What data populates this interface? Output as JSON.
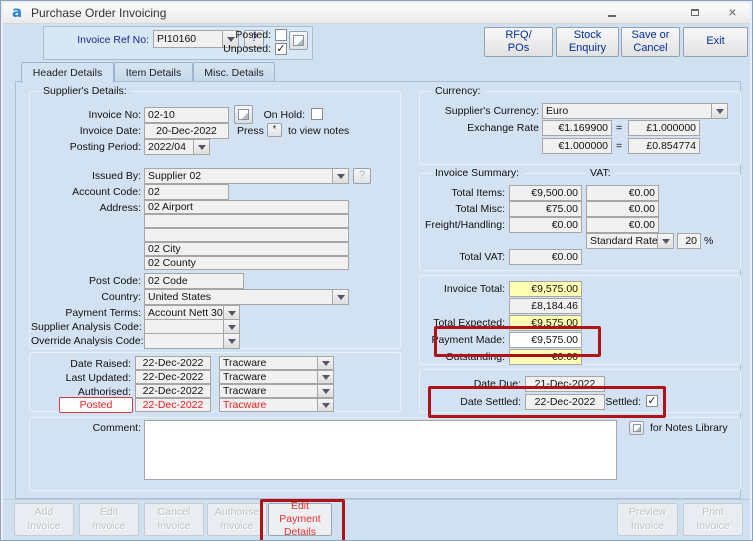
{
  "window": {
    "title": "Purchase Order Invoicing",
    "logo_letter": "a"
  },
  "header": {
    "invoice_ref": {
      "label": "Invoice Ref No:",
      "value": "PI10160"
    },
    "help_button": "?",
    "posted": {
      "label": "Posted:",
      "checked": false
    },
    "unposted": {
      "label": "Unposted:",
      "checked": true
    },
    "actions": {
      "rfq_pos": [
        "RFQ/",
        "POs"
      ],
      "stock_enquiry": [
        "Stock",
        "Enquiry"
      ],
      "save_or_cancel": [
        "Save or",
        "Cancel"
      ],
      "exit": "Exit"
    }
  },
  "tabs": [
    {
      "label": "Header Details"
    },
    {
      "label": "Item Details"
    },
    {
      "label": "Misc. Details"
    }
  ],
  "supplier_details": {
    "legend": "Supplier's Details:",
    "invoice_no": {
      "label": "Invoice No:",
      "value": "02-10"
    },
    "on_hold": {
      "label": "On Hold:",
      "checked": false
    },
    "invoice_date": {
      "label": "Invoice Date:",
      "value": "20-Dec-2022"
    },
    "notes_hint": {
      "prefix": "Press",
      "key": "*",
      "suffix": "to view notes"
    },
    "posting_period": {
      "label": "Posting Period:",
      "value": "2022/04"
    },
    "issued_by": {
      "label": "Issued By:",
      "value": "Supplier 02",
      "help": "?"
    },
    "account_code": {
      "label": "Account Code:",
      "value": "02"
    },
    "address": {
      "label": "Address:",
      "lines": [
        "02 Airport",
        "",
        "",
        "02 City",
        "02 County"
      ]
    },
    "post_code": {
      "label": "Post Code:",
      "value": "02 Code"
    },
    "country": {
      "label": "Country:",
      "value": "United States"
    },
    "payment_terms": {
      "label": "Payment Terms:",
      "value": "Account Nett 30"
    },
    "supplier_analysis_code": {
      "label": "Supplier Analysis Code:",
      "value": ""
    },
    "override_analysis_code": {
      "label": "Override Analysis Code:",
      "value": ""
    }
  },
  "audit": {
    "rows": [
      {
        "label": "Date Raised:",
        "date": "22-Dec-2022",
        "user": "Tracware"
      },
      {
        "label": "Last Updated:",
        "date": "22-Dec-2022",
        "user": "Tracware"
      },
      {
        "label": "Authorised:",
        "date": "22-Dec-2022",
        "user": "Tracware"
      },
      {
        "label": "Posted",
        "date": "22-Dec-2022",
        "user": "Tracware"
      }
    ]
  },
  "currency": {
    "legend": "Currency:",
    "suppliers_currency": {
      "label": "Supplier's Currency:",
      "value": "Euro"
    },
    "exchange_rate_label": "Exchange Rate",
    "rates": [
      {
        "from": "€1.169900",
        "equals": "=",
        "to": "£1.000000"
      },
      {
        "from": "€1.000000",
        "equals": "=",
        "to": "£0.854774"
      }
    ]
  },
  "invoice_summary": {
    "legend": "Invoice Summary:",
    "vat_heading": "VAT:",
    "total_items": {
      "label": "Total Items:",
      "value": "€9,500.00",
      "vat": "€0.00"
    },
    "total_misc": {
      "label": "Total Misc:",
      "value": "€75.00",
      "vat": "€0.00"
    },
    "freight_handling": {
      "label": "Freight/Handling:",
      "value": "€0.00",
      "vat": "€0.00"
    },
    "vat_rate": {
      "name": "Standard Rate",
      "percent": "20",
      "percent_sign": "%"
    },
    "total_vat": {
      "label": "Total VAT:",
      "value": "€0.00"
    }
  },
  "totals": {
    "invoice_total": {
      "label": "Invoice Total:",
      "value": "€9,575.00"
    },
    "invoice_total_base": "£8,184.46",
    "total_expected": {
      "label": "Total Expected:",
      "value": "€9,575.00"
    },
    "payment_made": {
      "label": "Payment Made:",
      "value": "€9,575.00"
    },
    "outstanding": {
      "label": "Outstanding:",
      "value": "€0.00"
    }
  },
  "settlement": {
    "date_due": {
      "label": "Date Due:",
      "value": "21-Dec-2022"
    },
    "date_settled": {
      "label": "Date Settled:",
      "value": "22-Dec-2022"
    },
    "settled": {
      "label": "Settled:",
      "checked": true
    }
  },
  "comment": {
    "label": "Comment:",
    "value": "",
    "notes_library_label": "for Notes Library"
  },
  "footer": {
    "buttons": [
      {
        "lines": [
          "Add",
          "Invoice"
        ],
        "enabled": false
      },
      {
        "lines": [
          "Edit",
          "Invoice"
        ],
        "enabled": false
      },
      {
        "lines": [
          "Cancel",
          "Invoice"
        ],
        "enabled": false
      },
      {
        "lines": [
          "Authorise",
          "Invoice"
        ],
        "enabled": false
      },
      {
        "lines": [
          "Edit Payment",
          "Details"
        ],
        "enabled": true
      },
      {
        "lines": [
          "Preview",
          "Invoice"
        ],
        "enabled": false
      },
      {
        "lines": [
          "Print",
          "Invoice"
        ],
        "enabled": false
      }
    ]
  },
  "colors": {
    "panel_blue": "#d3e2f2",
    "highlight_yellow": "#ffffb4",
    "annotation_red": "#b01218",
    "alert_text_red": "#ee1c1c",
    "button_text_blue": "#002f9e"
  }
}
